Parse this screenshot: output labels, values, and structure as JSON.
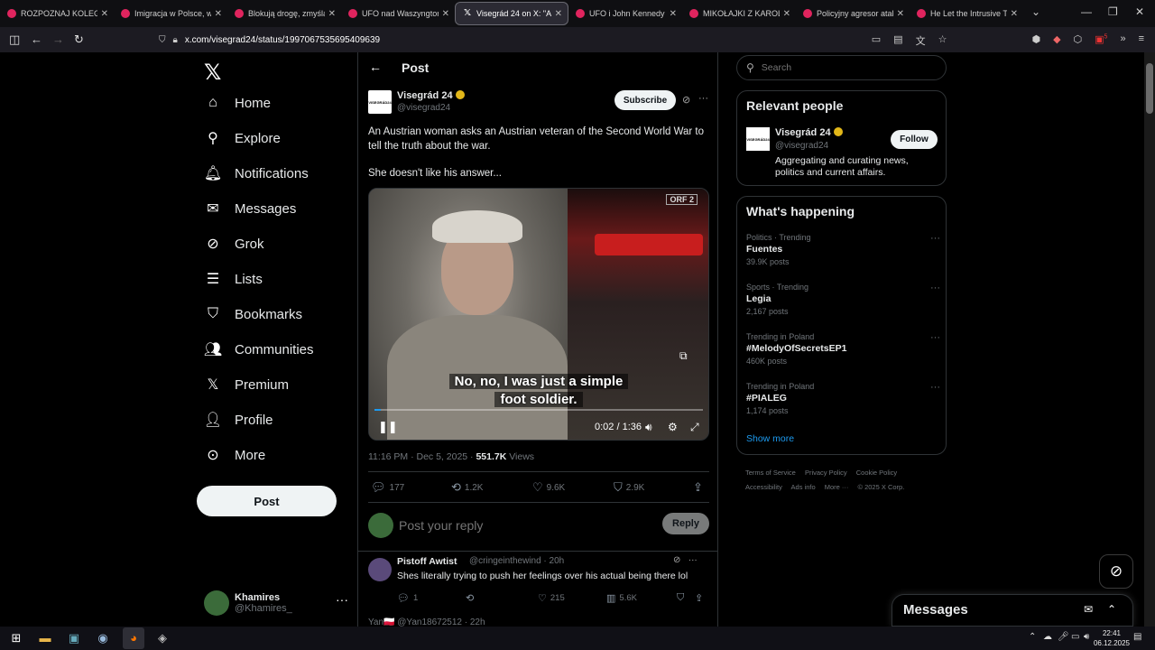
{
  "browser": {
    "tabs": [
      {
        "label": "ROZPOZNAJ KOLEGĘ PO",
        "icon": "youtube-icon"
      },
      {
        "label": "Imigracja w Polsce, wsch",
        "icon": "youtube-icon"
      },
      {
        "label": "Blokują drogę, zmyślają",
        "icon": "youtube-icon"
      },
      {
        "label": "UFO nad Waszyngtonem",
        "icon": "youtube-icon"
      },
      {
        "label": "Visegrád 24 on X: \"A",
        "icon": "x-icon"
      },
      {
        "label": "UFO i John Kennedy - Po",
        "icon": "youtube-icon"
      },
      {
        "label": "MIKOŁAJKI Z KAROLEM",
        "icon": "youtube-icon"
      },
      {
        "label": "Policyjny agresor atakuje",
        "icon": "youtube-icon"
      },
      {
        "label": "He Let the Intrusive Thou",
        "icon": "youtube-icon"
      }
    ],
    "url": "x.com/visegrad24/status/1997067535695409639",
    "notification_count": "5"
  },
  "nav": {
    "items": [
      {
        "label": "Home",
        "icon": "home-icon"
      },
      {
        "label": "Explore",
        "icon": "search-icon"
      },
      {
        "label": "Notifications",
        "icon": "bell-icon"
      },
      {
        "label": "Messages",
        "icon": "mail-icon"
      },
      {
        "label": "Grok",
        "icon": "grok-icon"
      },
      {
        "label": "Lists",
        "icon": "list-icon"
      },
      {
        "label": "Bookmarks",
        "icon": "bookmark-icon"
      },
      {
        "label": "Communities",
        "icon": "people-icon"
      },
      {
        "label": "Premium",
        "icon": "x-icon"
      },
      {
        "label": "Profile",
        "icon": "person-icon"
      },
      {
        "label": "More",
        "icon": "more-circle-icon"
      }
    ],
    "post_button": "Post",
    "account": {
      "name": "Khamires",
      "handle": "@Khamires_"
    }
  },
  "post": {
    "header_title": "Post",
    "author_name": "Visegrád 24",
    "author_handle": "@visegrad24",
    "logo_text": "VISEGRÁD24",
    "subscribe_label": "Subscribe",
    "text_line1": "An Austrian woman asks an Austrian veteran of the Second World War to tell the truth about the war.",
    "text_line2": "She doesn't like his answer...",
    "video": {
      "subtitle_line1": "No, no, I was just a simple",
      "subtitle_line2": "foot soldier.",
      "time": "0:02 / 1:36",
      "progress": 0.02,
      "badge": "ORF 2"
    },
    "timestamp": "11:16 PM · Dec 5, 2025 · ",
    "views_count": "551.7K",
    "views_label": " Views",
    "stats": {
      "replies": "177",
      "reposts": "1.2K",
      "likes": "9.6K",
      "bookmarks": "2.9K"
    },
    "reply_placeholder": "Post your reply",
    "reply_button": "Reply"
  },
  "comments": [
    {
      "name": "Pistoff Awtist",
      "handle": "@cringeinthewind · 20h",
      "text": "Shes literally trying to push her feelings over his actual being there lol",
      "replies": "1",
      "likes": "215",
      "views": "5.6K"
    }
  ],
  "next_comment_peek": "Yan🇵🇱 @Yan18672512 · 22h",
  "right": {
    "search_placeholder": "Search",
    "relevant_title": "Relevant people",
    "person": {
      "name": "Visegrád 24",
      "handle": "@visegrad24",
      "bio": "Aggregating and curating news, politics and current affairs.",
      "follow_label": "Follow"
    },
    "happening_title": "What's happening",
    "trends": [
      {
        "category": "Politics · Trending",
        "name": "Fuentes",
        "count": "39.9K posts"
      },
      {
        "category": "Sports · Trending",
        "name": "Legia",
        "count": "2,167 posts"
      },
      {
        "category": "Trending in Poland",
        "name": "#MelodyOfSecretsEP1",
        "count": "460K posts"
      },
      {
        "category": "Trending in Poland",
        "name": "#PIALEG",
        "count": "1,174 posts"
      }
    ],
    "show_more": "Show more",
    "footer": [
      "Terms of Service",
      "Privacy Policy",
      "Cookie Policy",
      "Accessibility",
      "Ads info",
      "More ···",
      "© 2025 X Corp."
    ]
  },
  "messages_dock": {
    "title": "Messages"
  },
  "taskbar": {
    "time": "22:41",
    "date": "06.12.2025"
  }
}
